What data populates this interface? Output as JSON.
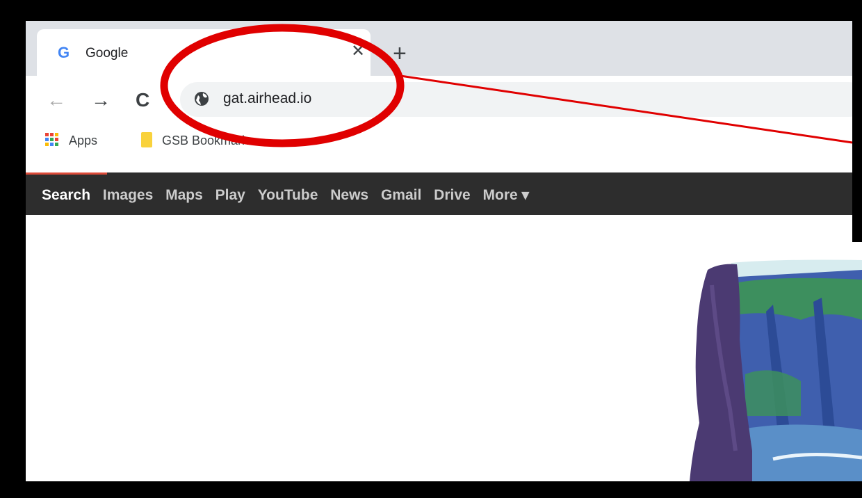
{
  "browser": {
    "tab": {
      "favicon": "G",
      "title": "Google",
      "close_glyph": "✕"
    },
    "new_tab_glyph": "+",
    "nav": {
      "back": "←",
      "forward": "→",
      "reload": "C"
    },
    "address": {
      "url": "gat.airhead.io",
      "icon": "globe-icon"
    },
    "bookmarks": [
      {
        "label": "Apps",
        "icon": "apps-grid-icon"
      },
      {
        "label": "GSB Bookmarks",
        "icon": "folder-icon"
      }
    ]
  },
  "google_bar": {
    "items": [
      {
        "label": "Search",
        "active": true
      },
      {
        "label": "Images"
      },
      {
        "label": "Maps"
      },
      {
        "label": "Play"
      },
      {
        "label": "YouTube"
      },
      {
        "label": "News"
      },
      {
        "label": "Gmail"
      },
      {
        "label": "Drive"
      },
      {
        "label": "More ▾"
      }
    ]
  },
  "colors": {
    "highlight": "#e00000",
    "google_bar_bg": "#2d2d2d",
    "active_underline": "#dd4b39"
  }
}
